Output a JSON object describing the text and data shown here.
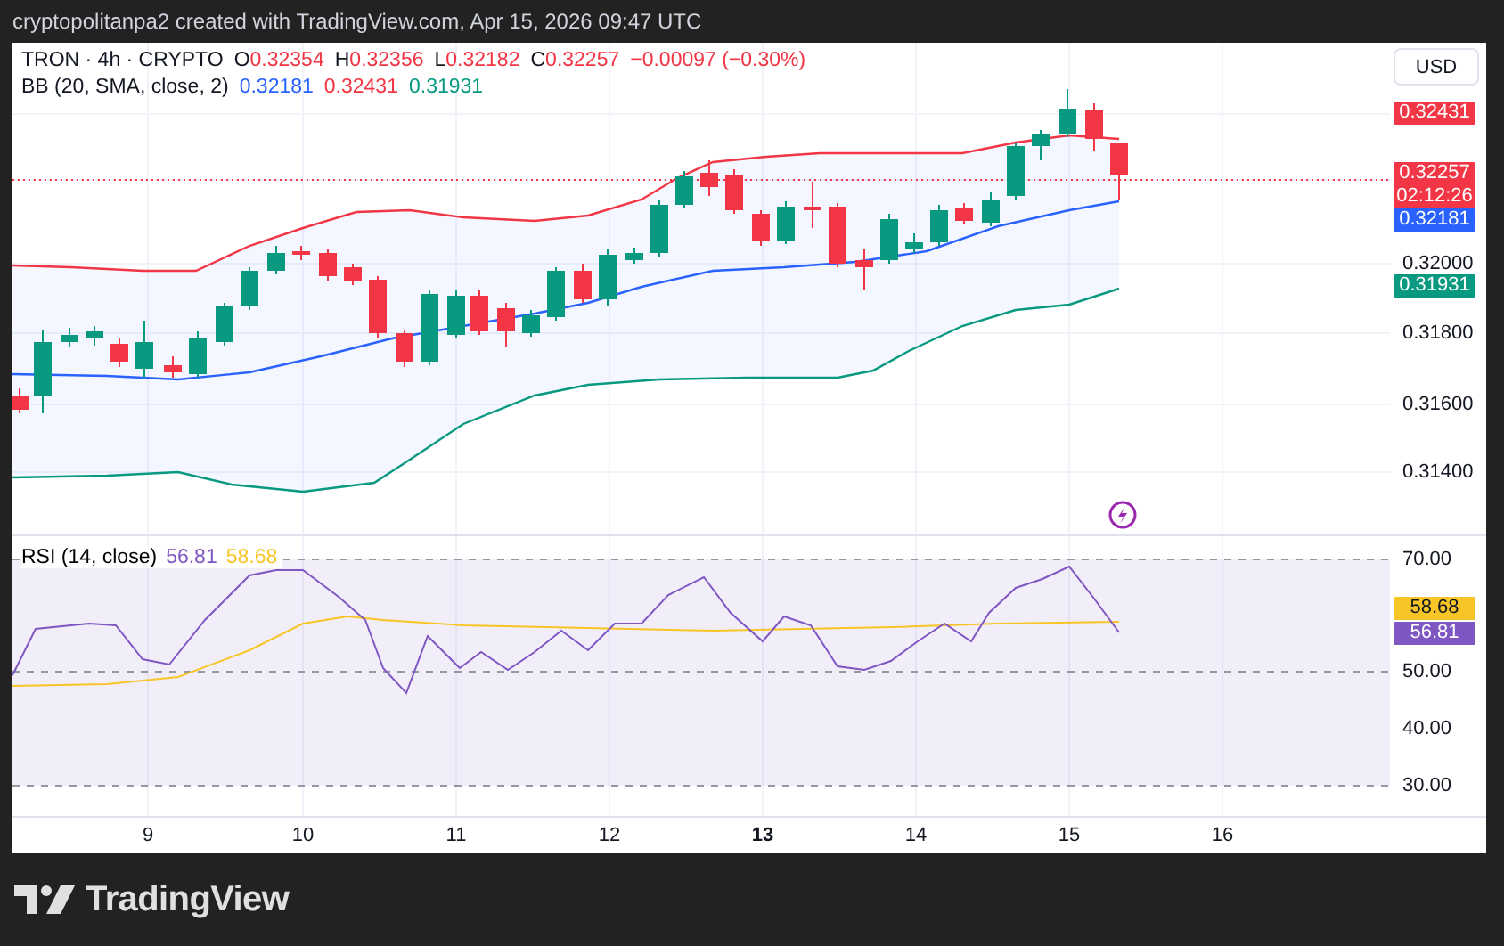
{
  "header": {
    "text": "cryptopolitanpa2 created with TradingView.com, Apr 15, 2026 09:47 UTC"
  },
  "price_pane": {
    "symbol": "TRON · 4h · CRYPTO",
    "ohlc": [
      {
        "label": "O",
        "value": "0.32354"
      },
      {
        "label": "H",
        "value": "0.32356"
      },
      {
        "label": "L",
        "value": "0.32182"
      },
      {
        "label": "C",
        "value": "0.32257"
      }
    ],
    "change": "−0.00097 (−0.30%)",
    "indicator": {
      "title": "BB (20, SMA, close, 2)",
      "values": [
        {
          "value": "0.32181",
          "color": "#2962ff"
        },
        {
          "value": "0.32431",
          "color": "#f23645"
        },
        {
          "value": "0.31931",
          "color": "#089981"
        }
      ]
    },
    "currency_button": "USD",
    "axis_labels": [
      {
        "kind": "badge",
        "text": "0.32431",
        "color": "#f23645"
      },
      {
        "kind": "badge",
        "text": "0.32257",
        "countdown": "02:12:26",
        "color": "#f23645"
      },
      {
        "kind": "badge",
        "text": "0.32181",
        "color": "#2962ff"
      },
      {
        "kind": "tick",
        "text": "0.32000"
      },
      {
        "kind": "badge",
        "text": "0.31931",
        "color": "#089981"
      },
      {
        "kind": "tick",
        "text": "0.31800"
      },
      {
        "kind": "tick",
        "text": "0.31600"
      },
      {
        "kind": "tick",
        "text": "0.31400"
      }
    ]
  },
  "rsi_pane": {
    "title": "RSI (14, close)",
    "values": [
      {
        "value": "56.81",
        "color": "#7e57c2"
      },
      {
        "value": "58.68",
        "color": "#f7c626"
      }
    ],
    "axis_labels": [
      {
        "kind": "tick",
        "text": "70.00"
      },
      {
        "kind": "badge",
        "text": "58.68",
        "color": "#f7c626"
      },
      {
        "kind": "badge",
        "text": "56.81",
        "color": "#7e57c2"
      },
      {
        "kind": "tick",
        "text": "50.00"
      },
      {
        "kind": "tick",
        "text": "40.00"
      },
      {
        "kind": "tick",
        "text": "30.00"
      }
    ]
  },
  "time_axis": [
    {
      "label": "9",
      "bold": false
    },
    {
      "label": "10",
      "bold": false
    },
    {
      "label": "11",
      "bold": false
    },
    {
      "label": "12",
      "bold": false
    },
    {
      "label": "13",
      "bold": true
    },
    {
      "label": "14",
      "bold": false
    },
    {
      "label": "15",
      "bold": false
    },
    {
      "label": "16",
      "bold": false
    }
  ],
  "footer": {
    "brand": "TradingView"
  }
}
